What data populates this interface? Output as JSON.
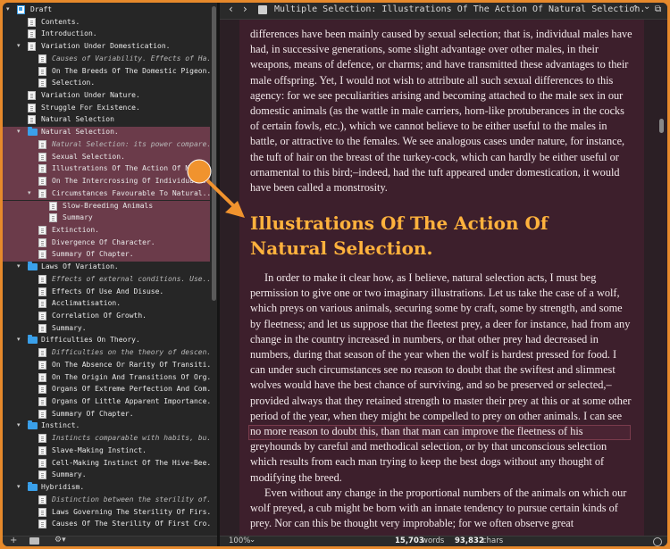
{
  "binder": {
    "rows": [
      {
        "label": "Draft",
        "icon": "draft",
        "indent": 0,
        "tri": "▾",
        "selected": false,
        "italic": false
      },
      {
        "label": "Contents.",
        "icon": "doc",
        "indent": 1,
        "tri": "",
        "selected": false,
        "italic": false
      },
      {
        "label": "Introduction.",
        "icon": "doc",
        "indent": 1,
        "tri": "",
        "selected": false,
        "italic": false
      },
      {
        "label": "Variation Under Domestication.",
        "icon": "doc",
        "indent": 1,
        "tri": "▾",
        "selected": false,
        "italic": false
      },
      {
        "label": "Causes of Variability. Effects of Ha...",
        "icon": "doc",
        "indent": 2,
        "tri": "",
        "selected": false,
        "italic": true
      },
      {
        "label": "On The Breeds Of The Domestic Pigeon.",
        "icon": "doc",
        "indent": 2,
        "tri": "",
        "selected": false,
        "italic": false
      },
      {
        "label": "Selection.",
        "icon": "doc",
        "indent": 2,
        "tri": "",
        "selected": false,
        "italic": false
      },
      {
        "label": "Variation Under Nature.",
        "icon": "doc",
        "indent": 1,
        "tri": "",
        "selected": false,
        "italic": false
      },
      {
        "label": "Struggle For Existence.",
        "icon": "doc",
        "indent": 1,
        "tri": "",
        "selected": false,
        "italic": false
      },
      {
        "label": "Natural Selection",
        "icon": "doc",
        "indent": 1,
        "tri": "",
        "selected": false,
        "italic": false
      },
      {
        "label": "Natural Selection.",
        "icon": "folder",
        "indent": 1,
        "tri": "▾",
        "selected": true,
        "italic": false
      },
      {
        "label": "Natural Selection: its power compare...",
        "icon": "doc",
        "indent": 2,
        "tri": "",
        "selected": true,
        "italic": true
      },
      {
        "label": "Sexual Selection.",
        "icon": "doc",
        "indent": 2,
        "tri": "",
        "selected": true,
        "italic": false
      },
      {
        "label": "Illustrations Of The Action Of Na",
        "icon": "doc",
        "indent": 2,
        "tri": "",
        "selected": true,
        "italic": false
      },
      {
        "label": "On The Intercrossing Of Individuals.",
        "icon": "doc",
        "indent": 2,
        "tri": "",
        "selected": true,
        "italic": false
      },
      {
        "label": "Circumstances Favourable To Natural...",
        "icon": "doc",
        "indent": 2,
        "tri": "▾",
        "selected": true,
        "italic": false
      },
      {
        "label": "Slow-Breeding Animals",
        "icon": "doc",
        "indent": 3,
        "tri": "",
        "selected": true,
        "italic": false
      },
      {
        "label": "Summary",
        "icon": "doc",
        "indent": 3,
        "tri": "",
        "selected": true,
        "italic": false
      },
      {
        "label": "Extinction.",
        "icon": "doc",
        "indent": 2,
        "tri": "",
        "selected": true,
        "italic": false
      },
      {
        "label": "Divergence Of Character.",
        "icon": "doc",
        "indent": 2,
        "tri": "",
        "selected": true,
        "italic": false
      },
      {
        "label": "Summary Of Chapter.",
        "icon": "doc",
        "indent": 2,
        "tri": "",
        "selected": true,
        "italic": false
      },
      {
        "label": "Laws Of Variation.",
        "icon": "folder",
        "indent": 1,
        "tri": "▾",
        "selected": false,
        "italic": false
      },
      {
        "label": "Effects of external conditions. Use...",
        "icon": "doc",
        "indent": 2,
        "tri": "",
        "selected": false,
        "italic": true
      },
      {
        "label": "Effects Of Use And Disuse.",
        "icon": "doc",
        "indent": 2,
        "tri": "",
        "selected": false,
        "italic": false
      },
      {
        "label": "Acclimatisation.",
        "icon": "doc",
        "indent": 2,
        "tri": "",
        "selected": false,
        "italic": false
      },
      {
        "label": "Correlation Of Growth.",
        "icon": "doc",
        "indent": 2,
        "tri": "",
        "selected": false,
        "italic": false
      },
      {
        "label": "Summary.",
        "icon": "doc",
        "indent": 2,
        "tri": "",
        "selected": false,
        "italic": false
      },
      {
        "label": "Difficulties On Theory.",
        "icon": "folder",
        "indent": 1,
        "tri": "▾",
        "selected": false,
        "italic": false
      },
      {
        "label": "Difficulties on the theory of descen...",
        "icon": "doc",
        "indent": 2,
        "tri": "",
        "selected": false,
        "italic": true
      },
      {
        "label": "On The Absence Or Rarity Of Transiti...",
        "icon": "doc",
        "indent": 2,
        "tri": "",
        "selected": false,
        "italic": false
      },
      {
        "label": "On The Origin And Transitions Of Org...",
        "icon": "doc",
        "indent": 2,
        "tri": "",
        "selected": false,
        "italic": false
      },
      {
        "label": "Organs Of Extreme Perfection And Com...",
        "icon": "doc",
        "indent": 2,
        "tri": "",
        "selected": false,
        "italic": false
      },
      {
        "label": "Organs Of Little Apparent Importance.",
        "icon": "doc",
        "indent": 2,
        "tri": "",
        "selected": false,
        "italic": false
      },
      {
        "label": "Summary Of Chapter.",
        "icon": "doc",
        "indent": 2,
        "tri": "",
        "selected": false,
        "italic": false
      },
      {
        "label": "Instinct.",
        "icon": "folder",
        "indent": 1,
        "tri": "▾",
        "selected": false,
        "italic": false
      },
      {
        "label": "Instincts comparable with habits, bu...",
        "icon": "doc",
        "indent": 2,
        "tri": "",
        "selected": false,
        "italic": true
      },
      {
        "label": "Slave-Making Instinct.",
        "icon": "doc",
        "indent": 2,
        "tri": "",
        "selected": false,
        "italic": false
      },
      {
        "label": "Cell-Making Instinct Of The Hive-Bee.",
        "icon": "doc",
        "indent": 2,
        "tri": "",
        "selected": false,
        "italic": false
      },
      {
        "label": "Summary.",
        "icon": "doc",
        "indent": 2,
        "tri": "",
        "selected": false,
        "italic": false
      },
      {
        "label": "Hybridism.",
        "icon": "folder",
        "indent": 1,
        "tri": "▾",
        "selected": false,
        "italic": false
      },
      {
        "label": "Distinction between the sterility of...",
        "icon": "doc",
        "indent": 2,
        "tri": "",
        "selected": false,
        "italic": true
      },
      {
        "label": "Laws Governing The Sterility Of Firs...",
        "icon": "doc",
        "indent": 2,
        "tri": "",
        "selected": false,
        "italic": false
      },
      {
        "label": "Causes Of The Sterility Of First Cro...",
        "icon": "doc",
        "indent": 2,
        "tri": "",
        "selected": false,
        "italic": false
      }
    ],
    "footer": {
      "add": "+",
      "add_folder_icon": "folder-plus-icon",
      "settings": "⚙▾"
    }
  },
  "header": {
    "back": "‹",
    "forward": "›",
    "title": "Multiple Selection: Illustrations Of The Action Of Natural Selection.",
    "up": "⌃",
    "down": "⌄",
    "split": "⧉"
  },
  "editor": {
    "para_top": "differences have been mainly caused by sexual selection; that is, individual males have had, in successive generations, some slight advantage over other males, in their weapons, means of defence, or charms; and have transmitted these advantages to their male offspring. Yet, I would not wish to attribute all such sexual differences to this agency: for we see peculiarities arising and becoming attached to the male sex in our domestic animals (as the wattle in male carriers, horn-like protuberances in the cocks of certain fowls, etc.), which we cannot believe to be either useful to the males in battle, or attractive to the females. We see analogous cases under nature, for instance, the tuft of hair on the breast of the turkey-cock, which can hardly be either useful or ornamental to this bird;–indeed, had the tuft appeared under domestication, it would have been called a monstrosity.",
    "chapter_title": "Illustrations Of The Action Of Natural Selection.",
    "para_main": "In order to make it clear how, as I believe, natural selection acts, I must beg permission to give one or two imaginary illustrations. Let us take the case of a wolf, which preys on various animals, securing some by craft, some by strength, and some by fleetness; and let us suppose that the fleetest prey, a deer for instance, had from any change in the country increased in numbers, or that other prey had decreased in numbers, during that season of the year when the wolf is hardest pressed for food. I can under such circumstances see no reason to doubt that the swiftest and slimmest wolves would have the best chance of surviving, and so be preserved or selected,–provided always that they retained strength to master their prey at this or at some other period of the year, when they might be compelled to prey on other animals. I can see no more reason to doubt this, than that man can improve the fleetness of his greyhounds by careful and methodical selection, or by that unconscious selection which results from each man trying to keep the best dogs without any thought of modifying the breed.",
    "para_last": "Even without any change in the proportional numbers of the animals on which our wolf preyed, a cub might be born with an innate tendency to pursue certain kinds of prey. Nor can this be thought very improbable; for we often observe great"
  },
  "footer": {
    "zoom": "100%",
    "zoom_caret": "⌄",
    "words_num": "15,703",
    "words_lbl": "words",
    "chars_num": "93,832",
    "chars_lbl": "chars",
    "target_icon": "target-icon"
  },
  "colors": {
    "accent": "#ffb23d",
    "selection": "#6b3b4a",
    "folder": "#3aa0ea",
    "annotation": "#f0932e"
  }
}
